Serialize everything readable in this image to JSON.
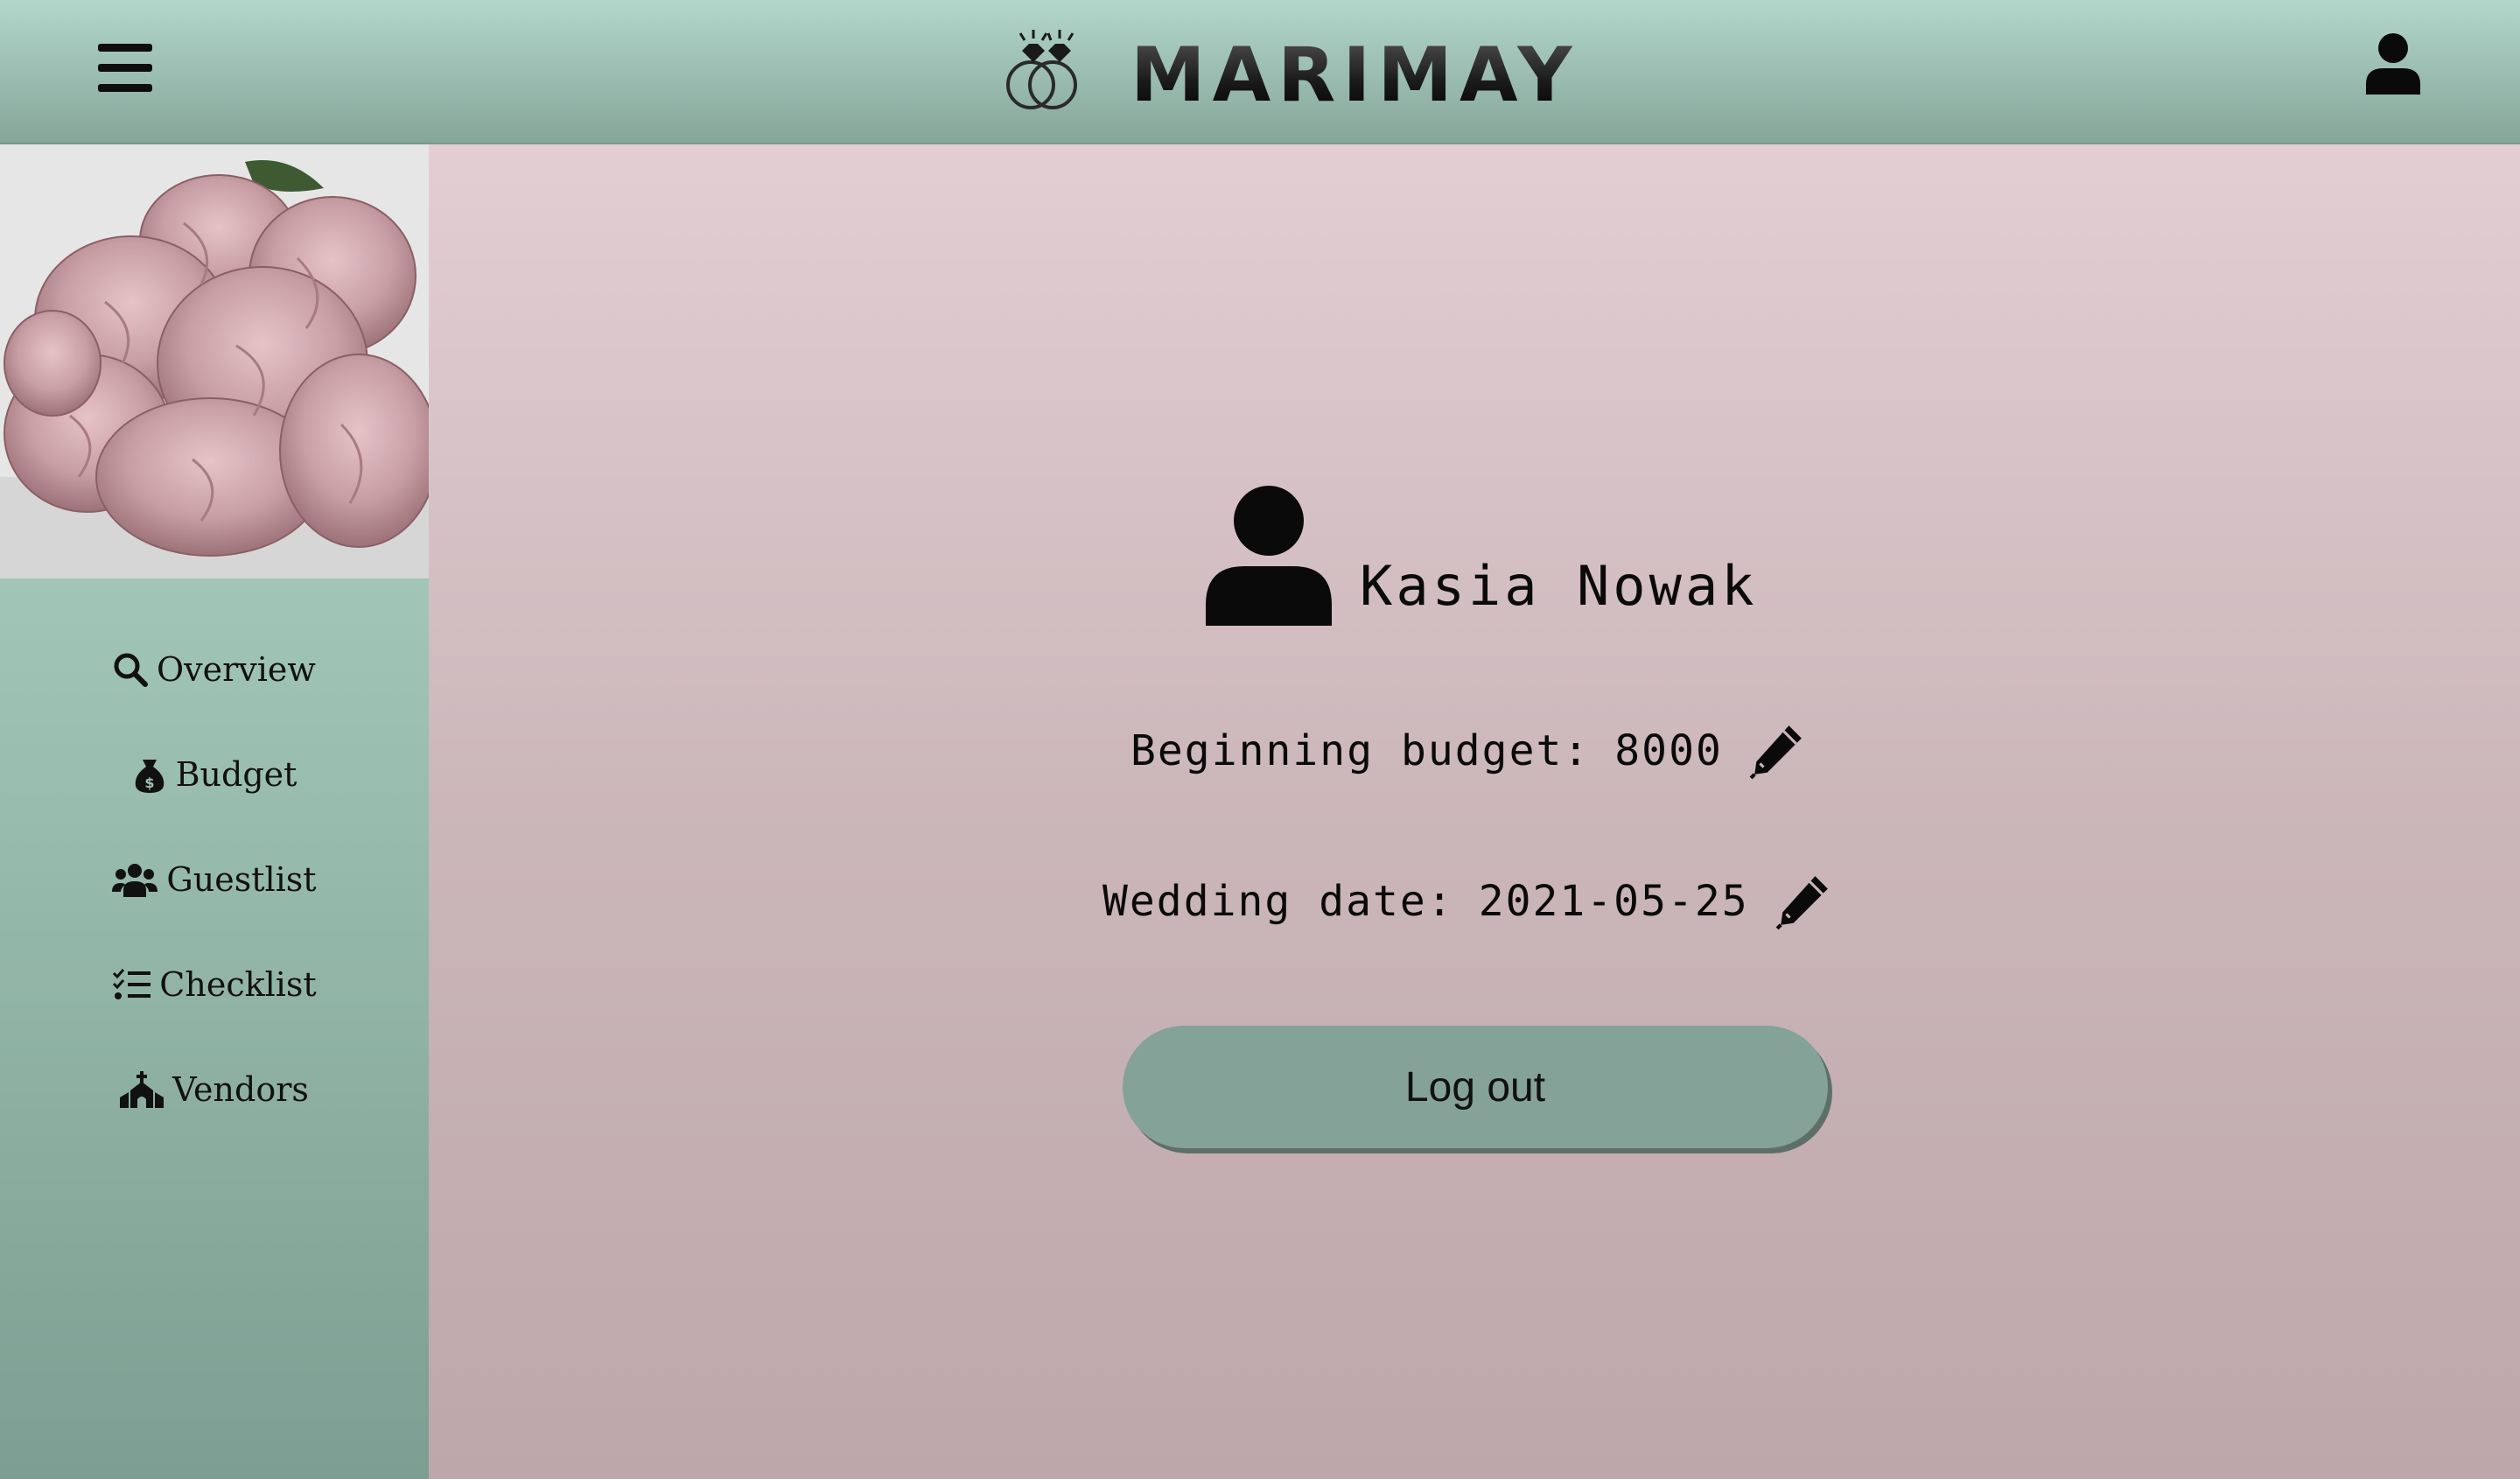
{
  "header": {
    "brand": "MARIMAY",
    "menu_icon": "hamburger-menu-icon",
    "account_icon": "user-icon"
  },
  "sidebar": {
    "image_desc": "flower-bouquet-icon",
    "items": [
      {
        "label": "Overview",
        "icon": "search-icon"
      },
      {
        "label": "Budget",
        "icon": "money-bag-icon"
      },
      {
        "label": "Guestlist",
        "icon": "users-icon"
      },
      {
        "label": "Checklist",
        "icon": "checklist-icon"
      },
      {
        "label": "Vendors",
        "icon": "church-icon"
      }
    ]
  },
  "profile": {
    "name": "Kasia Nowak",
    "budget_label": "Beginning budget:",
    "budget_value": "8000",
    "date_label": "Wedding date:",
    "date_value": "2021-05-25",
    "logout_label": "Log out"
  },
  "colors": {
    "header_green": "#9fc0b4",
    "main_pink": "#cbb6ba",
    "button_green": "#84a297"
  }
}
